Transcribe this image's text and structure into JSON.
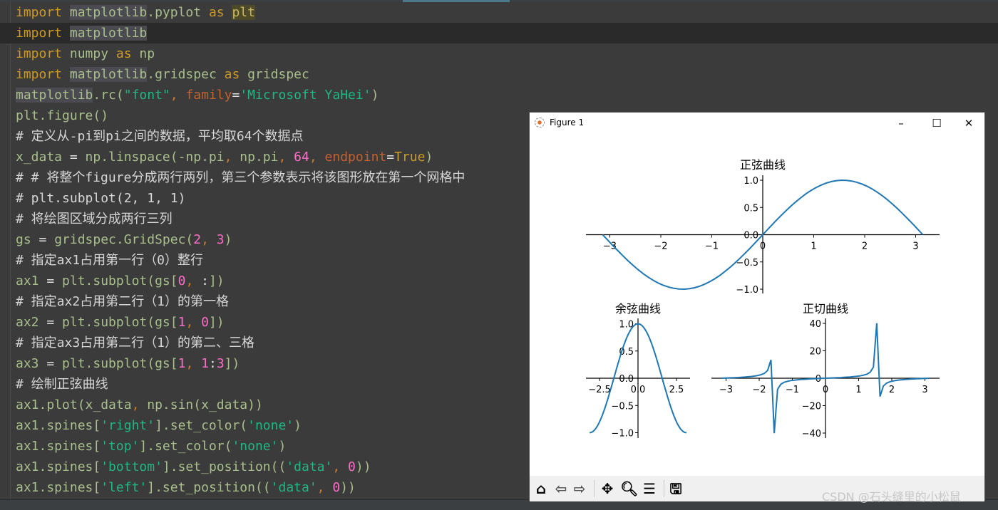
{
  "editor": {
    "lines": [
      [
        [
          "import",
          "k"
        ],
        [
          " ",
          "o"
        ],
        [
          "matplotlib",
          "g"
        ],
        [
          ".pyplot ",
          "i"
        ],
        [
          "as",
          "k"
        ],
        [
          " ",
          "o"
        ],
        [
          "plt",
          "hl"
        ]
      ],
      [
        [
          "import",
          "k"
        ],
        [
          " ",
          "o"
        ],
        [
          "matplotlib",
          "g"
        ]
      ],
      [
        [
          "import",
          "k"
        ],
        [
          " numpy ",
          "i"
        ],
        [
          "as",
          "k"
        ],
        [
          " np",
          "i"
        ]
      ],
      [
        [
          "import",
          "k"
        ],
        [
          " ",
          "o"
        ],
        [
          "matplotlib",
          "g"
        ],
        [
          ".gridspec ",
          "i"
        ],
        [
          "as",
          "k"
        ],
        [
          " gridspec",
          "i"
        ]
      ],
      [
        [
          "matplotlib",
          "g"
        ],
        [
          ".rc(",
          "i"
        ],
        [
          "\"font\"",
          "s"
        ],
        [
          ", ",
          "m"
        ],
        [
          "family",
          "p"
        ],
        [
          "=",
          "o"
        ],
        [
          "'Microsoft YaHei'",
          "s"
        ],
        [
          ")",
          "i"
        ]
      ],
      [
        [
          "plt.figure()",
          "i"
        ]
      ],
      [
        [
          "# 定义从-pi到pi之间的数据，平均取64个数据点",
          "c"
        ]
      ],
      [
        [
          "x_data ",
          "i"
        ],
        [
          "=",
          "o"
        ],
        [
          " np.linspace(-np.pi",
          "i"
        ],
        [
          ", ",
          "m"
        ],
        [
          "np.pi",
          "i"
        ],
        [
          ", ",
          "m"
        ],
        [
          "64",
          "n"
        ],
        [
          ", ",
          "m"
        ],
        [
          "endpoint",
          "p"
        ],
        [
          "=",
          "o"
        ],
        [
          "True",
          "k"
        ],
        [
          ")",
          "i"
        ]
      ],
      [
        [
          "# # 将整个figure分成两行两列，第三个参数表示将该图形放在第一个网格中",
          "c"
        ]
      ],
      [
        [
          "# plt.subplot(2, 1, 1)",
          "c"
        ]
      ],
      [
        [
          "# 将绘图区域分成两行三列",
          "c"
        ]
      ],
      [
        [
          "gs ",
          "i"
        ],
        [
          "=",
          "o"
        ],
        [
          " gridspec.GridSpec(",
          "i"
        ],
        [
          "2",
          "n"
        ],
        [
          ", ",
          "m"
        ],
        [
          "3",
          "n"
        ],
        [
          ")",
          "i"
        ]
      ],
      [
        [
          "# 指定ax1占用第一行（0）整行",
          "c"
        ]
      ],
      [
        [
          "ax1 ",
          "i"
        ],
        [
          "=",
          "o"
        ],
        [
          " plt.subplot(gs[",
          "i"
        ],
        [
          "0",
          "n"
        ],
        [
          ", ",
          "m"
        ],
        [
          ":",
          "o"
        ],
        [
          "])",
          "i"
        ]
      ],
      [
        [
          "# 指定ax2占用第二行（1）的第一格",
          "c"
        ]
      ],
      [
        [
          "ax2 ",
          "i"
        ],
        [
          "=",
          "o"
        ],
        [
          " plt.subplot(gs[",
          "i"
        ],
        [
          "1",
          "n"
        ],
        [
          ", ",
          "m"
        ],
        [
          "0",
          "n"
        ],
        [
          "])",
          "i"
        ]
      ],
      [
        [
          "# 指定ax3占用第二行（1）的第二、三格",
          "c"
        ]
      ],
      [
        [
          "ax3 ",
          "i"
        ],
        [
          "=",
          "o"
        ],
        [
          " plt.subplot(gs[",
          "i"
        ],
        [
          "1",
          "n"
        ],
        [
          ", ",
          "m"
        ],
        [
          "1",
          "n"
        ],
        [
          ":",
          "o"
        ],
        [
          "3",
          "n"
        ],
        [
          "])",
          "i"
        ]
      ],
      [
        [
          "# 绘制正弦曲线",
          "c"
        ]
      ],
      [
        [
          "ax1.plot(x_data",
          "i"
        ],
        [
          ", ",
          "m"
        ],
        [
          "np.sin(x_data))",
          "i"
        ]
      ],
      [
        [
          "ax1.spines[",
          "i"
        ],
        [
          "'right'",
          "s"
        ],
        [
          "].set_color(",
          "i"
        ],
        [
          "'none'",
          "s"
        ],
        [
          ")",
          "i"
        ]
      ],
      [
        [
          "ax1.spines[",
          "i"
        ],
        [
          "'top'",
          "s"
        ],
        [
          "].set_color(",
          "i"
        ],
        [
          "'none'",
          "s"
        ],
        [
          ")",
          "i"
        ]
      ],
      [
        [
          "ax1.spines[",
          "i"
        ],
        [
          "'bottom'",
          "s"
        ],
        [
          "].set_position((",
          "i"
        ],
        [
          "'data'",
          "s"
        ],
        [
          ", ",
          "m"
        ],
        [
          "0",
          "n"
        ],
        [
          "))",
          "i"
        ]
      ],
      [
        [
          "ax1.spines[",
          "i"
        ],
        [
          "'left'",
          "s"
        ],
        [
          "].set_position((",
          "i"
        ],
        [
          "'data'",
          "s"
        ],
        [
          ", ",
          "m"
        ],
        [
          "0",
          "n"
        ],
        [
          "))",
          "i"
        ]
      ]
    ],
    "current_line": 1,
    "colors": {
      "background": "#3b3b3b",
      "keyword": "#cc9a25",
      "string": "#1fb784",
      "number": "#ff6bc8"
    }
  },
  "figure_window": {
    "title": "Figure 1",
    "minimize_icon": "–",
    "maximize_icon": "☐",
    "close_icon": "✕",
    "toolbar": {
      "home": "home-icon",
      "back": "back-arrow-icon",
      "forward": "forward-arrow-icon",
      "pan": "pan-icon",
      "zoom": "zoom-icon",
      "configure": "configure-subplots-icon",
      "save": "save-icon"
    }
  },
  "chart_data": [
    {
      "type": "line",
      "title": "正弦曲线",
      "function": "sin",
      "x_range": [
        -3.14159,
        3.14159
      ],
      "points": 64,
      "xticks": [
        "−3",
        "−2",
        "−1",
        "0",
        "1",
        "2",
        "3"
      ],
      "xtick_values": [
        -3,
        -2,
        -1,
        0,
        1,
        2,
        3
      ],
      "yticks": [
        "−1.0",
        "−0.5",
        "0.0",
        "0.5",
        "1.0"
      ],
      "ytick_values": [
        -1,
        -0.5,
        0,
        0.5,
        1
      ],
      "spines": "centered at origin",
      "color": "#1f77b4"
    },
    {
      "type": "line",
      "title": "余弦曲线",
      "function": "cos",
      "x_range": [
        -3.14159,
        3.14159
      ],
      "points": 64,
      "xticks": [
        "−2.5",
        "0.0",
        "2.5"
      ],
      "xtick_values": [
        -2.5,
        0,
        2.5
      ],
      "yticks": [
        "−1.0",
        "−0.5",
        "0.0",
        "0.5",
        "1.0"
      ],
      "ytick_values": [
        -1,
        -0.5,
        0,
        0.5,
        1
      ],
      "spines": "centered at origin",
      "color": "#1f77b4"
    },
    {
      "type": "line",
      "title": "正切曲线",
      "function": "tan",
      "x_range": [
        -3.14159,
        3.14159
      ],
      "points": 64,
      "xticks": [
        "−3",
        "−2",
        "−1",
        "0",
        "1",
        "2",
        "3"
      ],
      "xtick_values": [
        -3,
        -2,
        -1,
        0,
        1,
        2,
        3
      ],
      "yticks": [
        "−40",
        "−20",
        "0",
        "20",
        "40"
      ],
      "ytick_values": [
        -40,
        -20,
        0,
        20,
        40
      ],
      "spines": "centered at origin",
      "color": "#1f77b4"
    }
  ],
  "watermark": "CSDN @石头缝里的小松鼠"
}
